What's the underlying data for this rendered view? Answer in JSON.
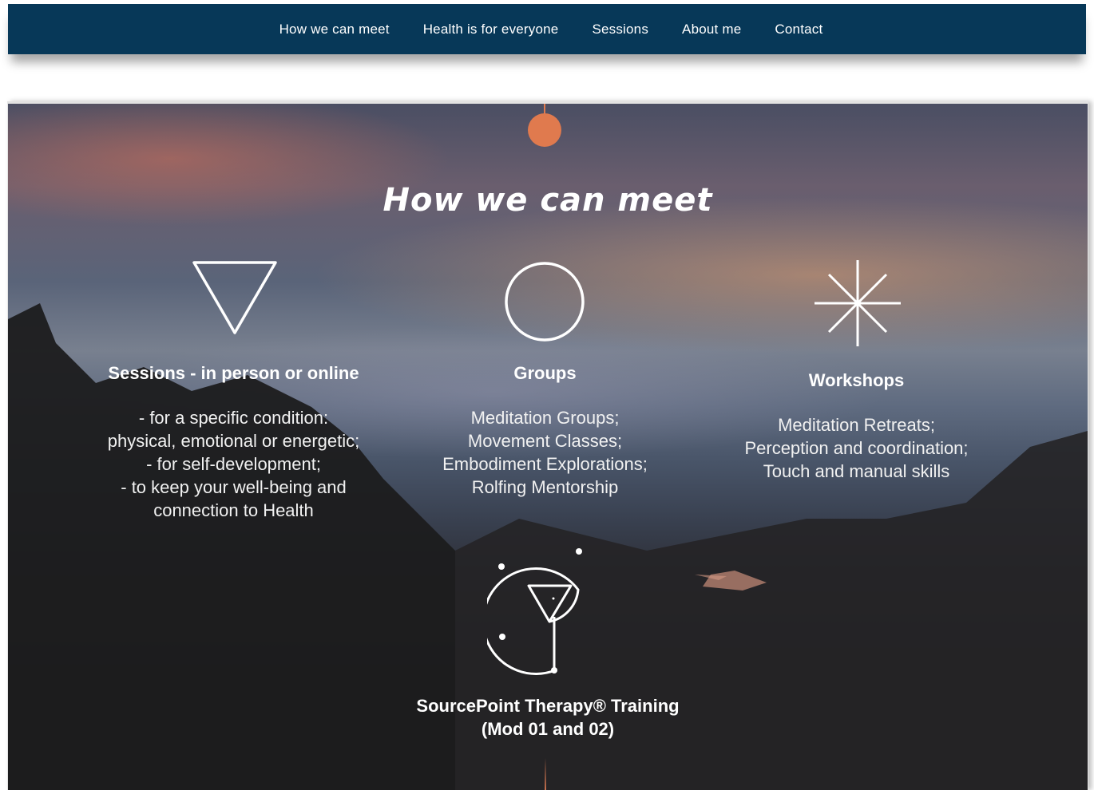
{
  "nav": {
    "items": [
      "How we can meet",
      "Health is for everyone",
      "Sessions",
      "About me",
      "Contact"
    ]
  },
  "hero": {
    "title": "How we can meet",
    "columns": [
      {
        "heading": "Sessions - in person or online",
        "lines": [
          "- for a specific condition:",
          "physical, emotional or energetic;",
          "- for self-development;",
          "- to keep your well-being and",
          "connection to Health"
        ]
      },
      {
        "heading": "Groups",
        "lines": [
          "Meditation Groups;",
          "Movement Classes;",
          "Embodiment Explorations;",
          "Rolfing Mentorship"
        ]
      },
      {
        "heading": "Workshops",
        "lines": [
          "Meditation Retreats;",
          "Perception and coordination;",
          "Touch and manual skills"
        ]
      }
    ],
    "training": {
      "line1": "SourcePoint Therapy® Training",
      "line2": "(Mod 01 and 02)"
    }
  },
  "icons": [
    "triangle-icon",
    "circle-icon",
    "asterisk-icon",
    "sourcepoint-logo-icon"
  ],
  "colors": {
    "nav_bg": "#073858",
    "accent": "#e07a4e",
    "text": "#ffffff"
  }
}
